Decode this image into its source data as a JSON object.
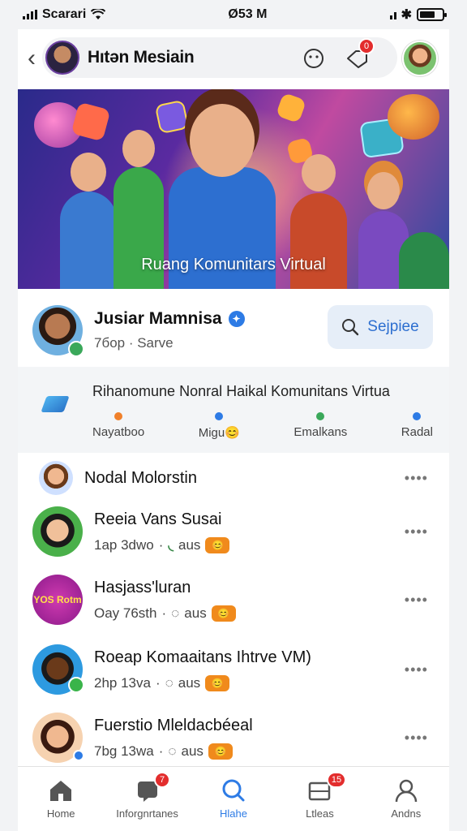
{
  "status_bar": {
    "carrier": "Scarari",
    "time": "Ø53 M"
  },
  "header": {
    "title": "Hıtən Mesiain",
    "notifications_count": "0"
  },
  "banner": {
    "caption": "Ruang Komunitars Virtual"
  },
  "profile": {
    "name": "Jusiar Mamnisa",
    "meta": "7бop · Sarve",
    "search_label": "Sejpiee"
  },
  "info": {
    "title": "Rihanomune Nonral Haikal Komunitans Virtua",
    "tags": [
      {
        "label": "Nayatboo",
        "color": "#f0802a"
      },
      {
        "label": "Migu😊",
        "color": "#2d7be5"
      },
      {
        "label": "Emalkans",
        "color": "#3aa85a"
      },
      {
        "label": "Radal",
        "color": "#2d7be5"
      }
    ]
  },
  "list": [
    {
      "name": "Nodal Molorstin",
      "sub": "",
      "more": "••••"
    },
    {
      "name": "Reeia Vans Susai",
      "time": "1ap 3dwo",
      "status": "aus",
      "more": "••••"
    },
    {
      "name": "Hasjass'luran",
      "time": "Oay 76sth",
      "status": "aus",
      "more": "••••"
    },
    {
      "name": "Roeap Komaaitans Ihtrve VM)",
      "time": "2hp 13va",
      "status": "aus",
      "more": "••••"
    },
    {
      "name": "Fuerstio Mleldacbéeal",
      "time": "7bg 13wa",
      "status": "aus",
      "more": "••••"
    }
  ],
  "avatar_badge_text": "YOS Rotm",
  "emoji_badge": "😊",
  "tabs": [
    {
      "label": "Home",
      "icon": "home-icon",
      "badge": ""
    },
    {
      "label": "Inforgnrtanes",
      "icon": "chat-icon",
      "badge": "7"
    },
    {
      "label": "Hlahe",
      "icon": "search-icon",
      "badge": ""
    },
    {
      "label": "Ltleas",
      "icon": "inbox-icon",
      "badge": "15"
    },
    {
      "label": "Andns",
      "icon": "user-icon",
      "badge": ""
    }
  ],
  "colors": {
    "accent": "#2d7be5",
    "alert": "#e32d2d"
  }
}
